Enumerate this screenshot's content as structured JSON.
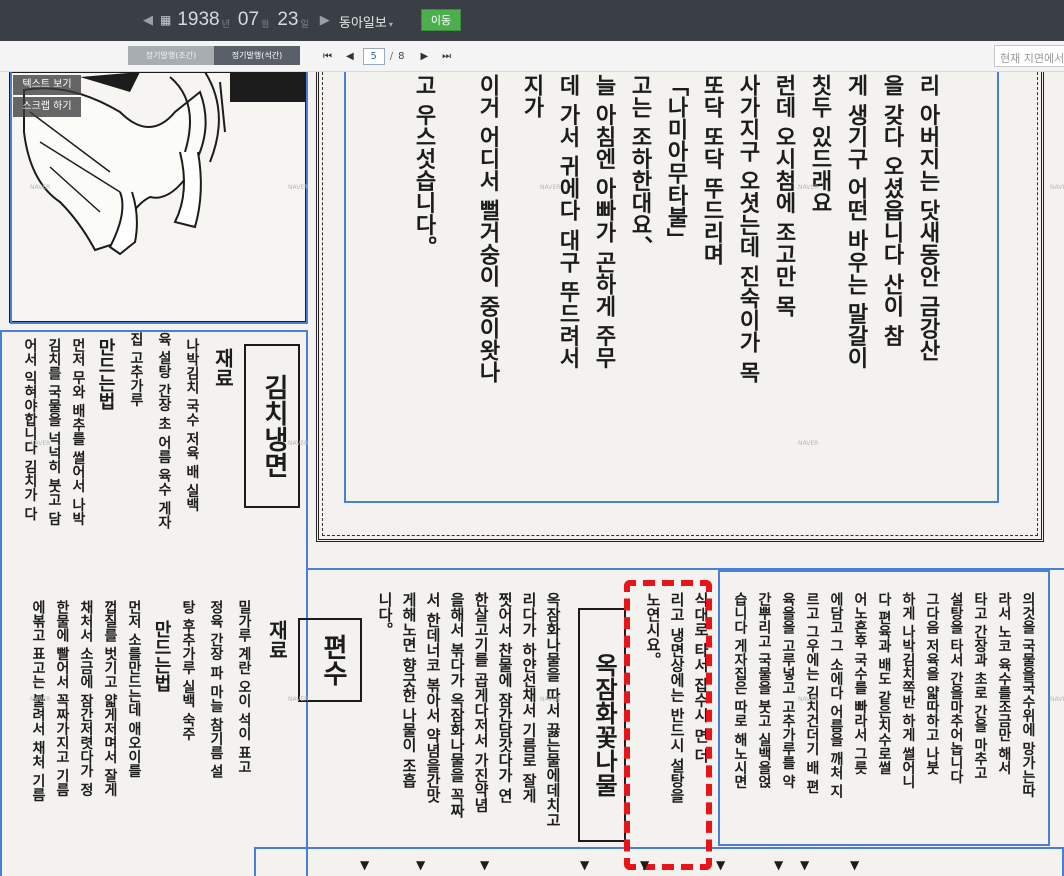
{
  "topbar": {
    "year": "1938",
    "year_unit": "년",
    "month": "07",
    "month_unit": "월",
    "day": "23",
    "day_unit": "일",
    "prev_icon": "◀",
    "next_icon": "▶",
    "calendar_icon": "▦",
    "newspaper": "동아일보",
    "dropdown_icon": "▾",
    "go_button": "이동"
  },
  "toolbar": {
    "tab_morning": "정기발행(조간)",
    "tab_evening": "정기발행(석간)",
    "first_icon": "⏮",
    "prev_icon": "◀",
    "next_icon": "▶",
    "last_icon": "⏭",
    "current_page": "5",
    "separator": "/",
    "total_pages": "8",
    "search_placeholder": "현재 지면에서"
  },
  "side_buttons": {
    "text_view": "텍스트 보기",
    "scrap": "스크랩 하기"
  },
  "watermark": "NAVER",
  "article_top": {
    "columns": [
      "리 아버지는 닷새동안 금강산",
      "을 갖다 오셨읍니다 산이 참",
      "게 생기구 어떤 바우는 말갈이",
      "칫두 있드래요",
      "런데 오시첨에 조고만 목",
      "사가지구 오셧는데 진숙이가 목",
      "또닥 또닥 뚜드리며",
      "「나미아무타불」",
      "고는 조하한대요、",
      "늘 아침엔 아빠가 곤하게 주무",
      "데 가서 귀에다 대구 뚜드려서",
      "지가",
      "이거 어디서 뻘거숭이 중이왓나",
      "고 우스섯습니다。"
    ]
  },
  "article_kimchi": {
    "title": "김치냉면",
    "section_ingredients": "재료",
    "section_method": "만드는법",
    "columns": [
      "나박김치 국수 저육 배 실백",
      "육 설탕 간장 초 어름 육수 게자",
      "집 고추가루",
      "먼저 무와 배추를 썰어서 나박",
      "김치를 국물을 넉넉히 붓고 담",
      "어서 익혀야합니다 김치가 다"
    ]
  },
  "article_pyeonsu": {
    "title": "편수",
    "section_ingredients": "재료",
    "section_method": "만드는법",
    "columns": [
      "밀가루 계란 오이 석이 표고",
      "정육 간장 파 마늘 참기름 설",
      "탕 후추가루 실백 숙주",
      "먼저 소를만드는데 애오이를",
      "껍질를 벗기고 얇게저며서 잘게",
      "채처서 소금에 잠간저렷다가 정",
      "한물에 빨어서 꼭짜가지고 기름",
      "에볶고 표고는 불려서 채처 기름"
    ]
  },
  "article_okjam": {
    "title": "옥잠화꽃나물",
    "columns": [
      "니다。",
      "게해노면 향긋한 나물이 조흡",
      "서 한데너코 볶아서 약념을간맛",
      "을해서 볶다가 옥잠화나물을 꼭짜",
      "한살고기를 곱게다저서 가진약념",
      "찟어서 찬물에 잠간담갓다가 연",
      "리다가 하얀선채서 기름로 잘게",
      "옥잠화나물을 따서 끓는물에데치고",
      "노연시요。",
      "리고 냉면상에는 반드시 설탕을",
      "식대로 타서 잡수시 면 더"
    ]
  },
  "article_right": {
    "columns": [
      "의것을 국물을국수위에 망가는따",
      "라서 노코 육수를조금만 해서",
      "타고 간장과 초로 간을 마추고",
      "설탕을 타서 간을마추어놉니다",
      "그다음 저육을 얇따하고 나붓",
      "하게 나박김치쪽반 하게 썰어니",
      "다 편육과 배도 같은치수로썰",
      "어노흔후 국수를 빠라서 그릇",
      "에담고 그 소에다 어름을 깨처 지",
      "르고 그우에는 김치건더기 배 편",
      "육을을 고루넣고 고추가루를 약",
      "간뿌리고 국물을 붓고 실백을얹",
      "습니다 게자집은 따로 해노시면"
    ]
  }
}
